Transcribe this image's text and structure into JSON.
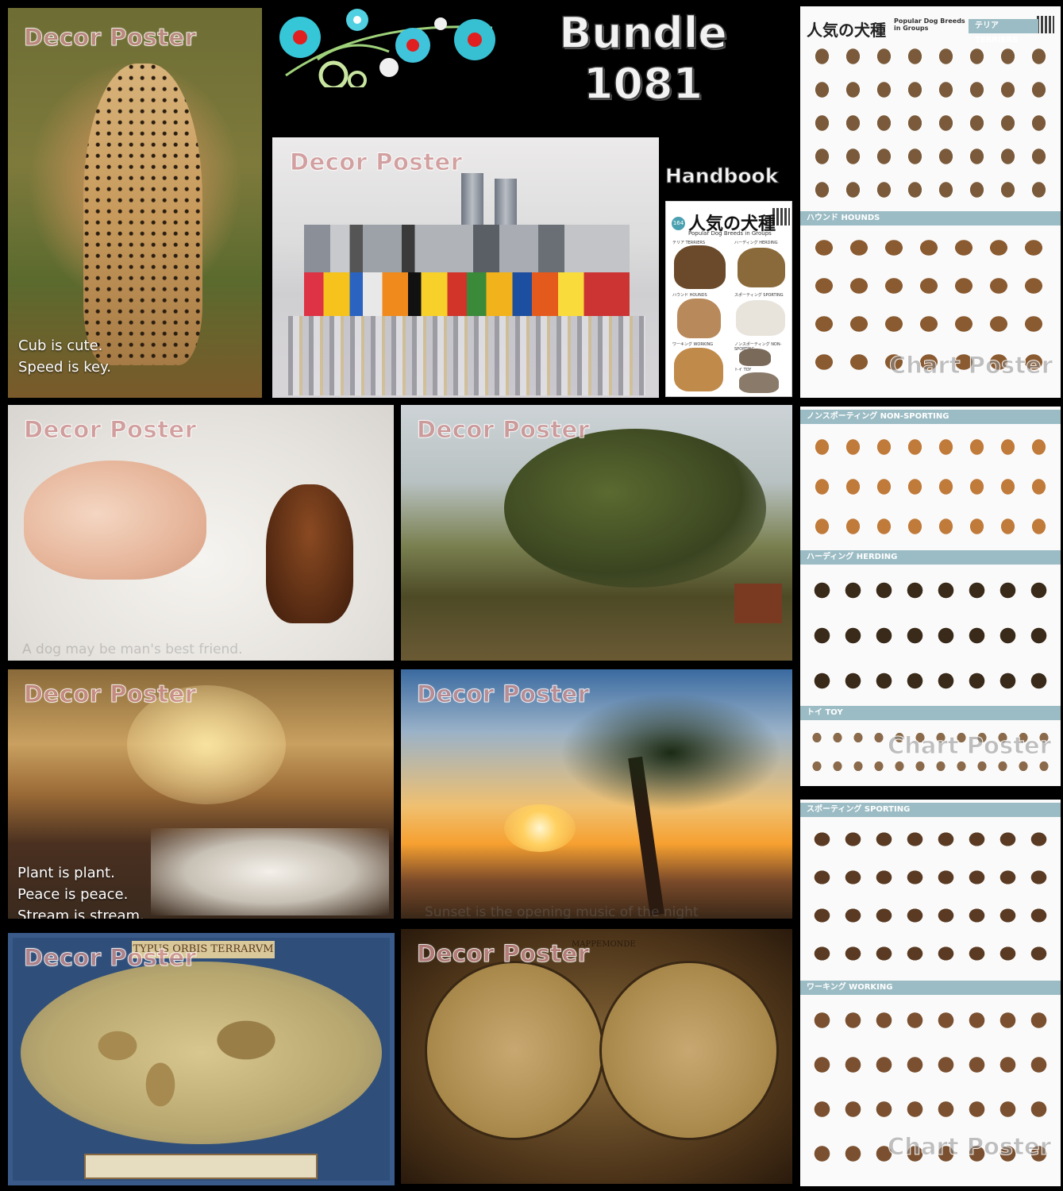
{
  "bundle": {
    "title_line1": "Bundle",
    "title_line2": "1081"
  },
  "watermark_decor": "Decor Poster",
  "watermark_chart": "Chart Poster",
  "handbook": {
    "label": "Handbook",
    "cover_number": "164",
    "cover_title": "人気の犬種",
    "cover_subtitle": "Popular Dog Breeds in Groups",
    "groups": [
      "テリア TERRIERS",
      "ハーディング HERDING",
      "ハウンド HOUNDS",
      "スポーティング SPORTING",
      "ワーキング WORKING",
      "ノンスポーティング NON-SPORTING",
      "トイ TOY"
    ]
  },
  "posters": {
    "cheetah": {
      "caption_line1": "Cub is cute.",
      "caption_line2": "Speed is key."
    },
    "baby_dog": {
      "caption": "A dog may be man's best friend."
    },
    "stream": {
      "caption_line1": "Plant is plant.",
      "caption_line2": "Peace is peace.",
      "caption_line3": "Stream is stream."
    },
    "sunset": {
      "caption": "Sunset is the opening music of the night"
    },
    "old_map1": {
      "banner": "TYPUS ORBIS TERRARVM"
    },
    "old_map2": {
      "banner": "MAPPEMONDE"
    }
  },
  "chart_poster_1": {
    "title_jp": "人気の犬種",
    "title_en": "Popular Dog Breeds in Groups",
    "section1": "テリア TERRIERS",
    "section2": "ハウンド HOUNDS"
  },
  "chart_poster_2": {
    "section1": "ノンスポーティング NON-SPORTING",
    "section2": "ハーディング HERDING",
    "section3": "トイ TOY"
  },
  "chart_poster_3": {
    "section1": "スポーティング SPORTING",
    "section2": "ワーキング WORKING"
  },
  "colors": {
    "background": "#000000",
    "section_header": "#9bbcc4",
    "watermark": "#b45a5a"
  }
}
